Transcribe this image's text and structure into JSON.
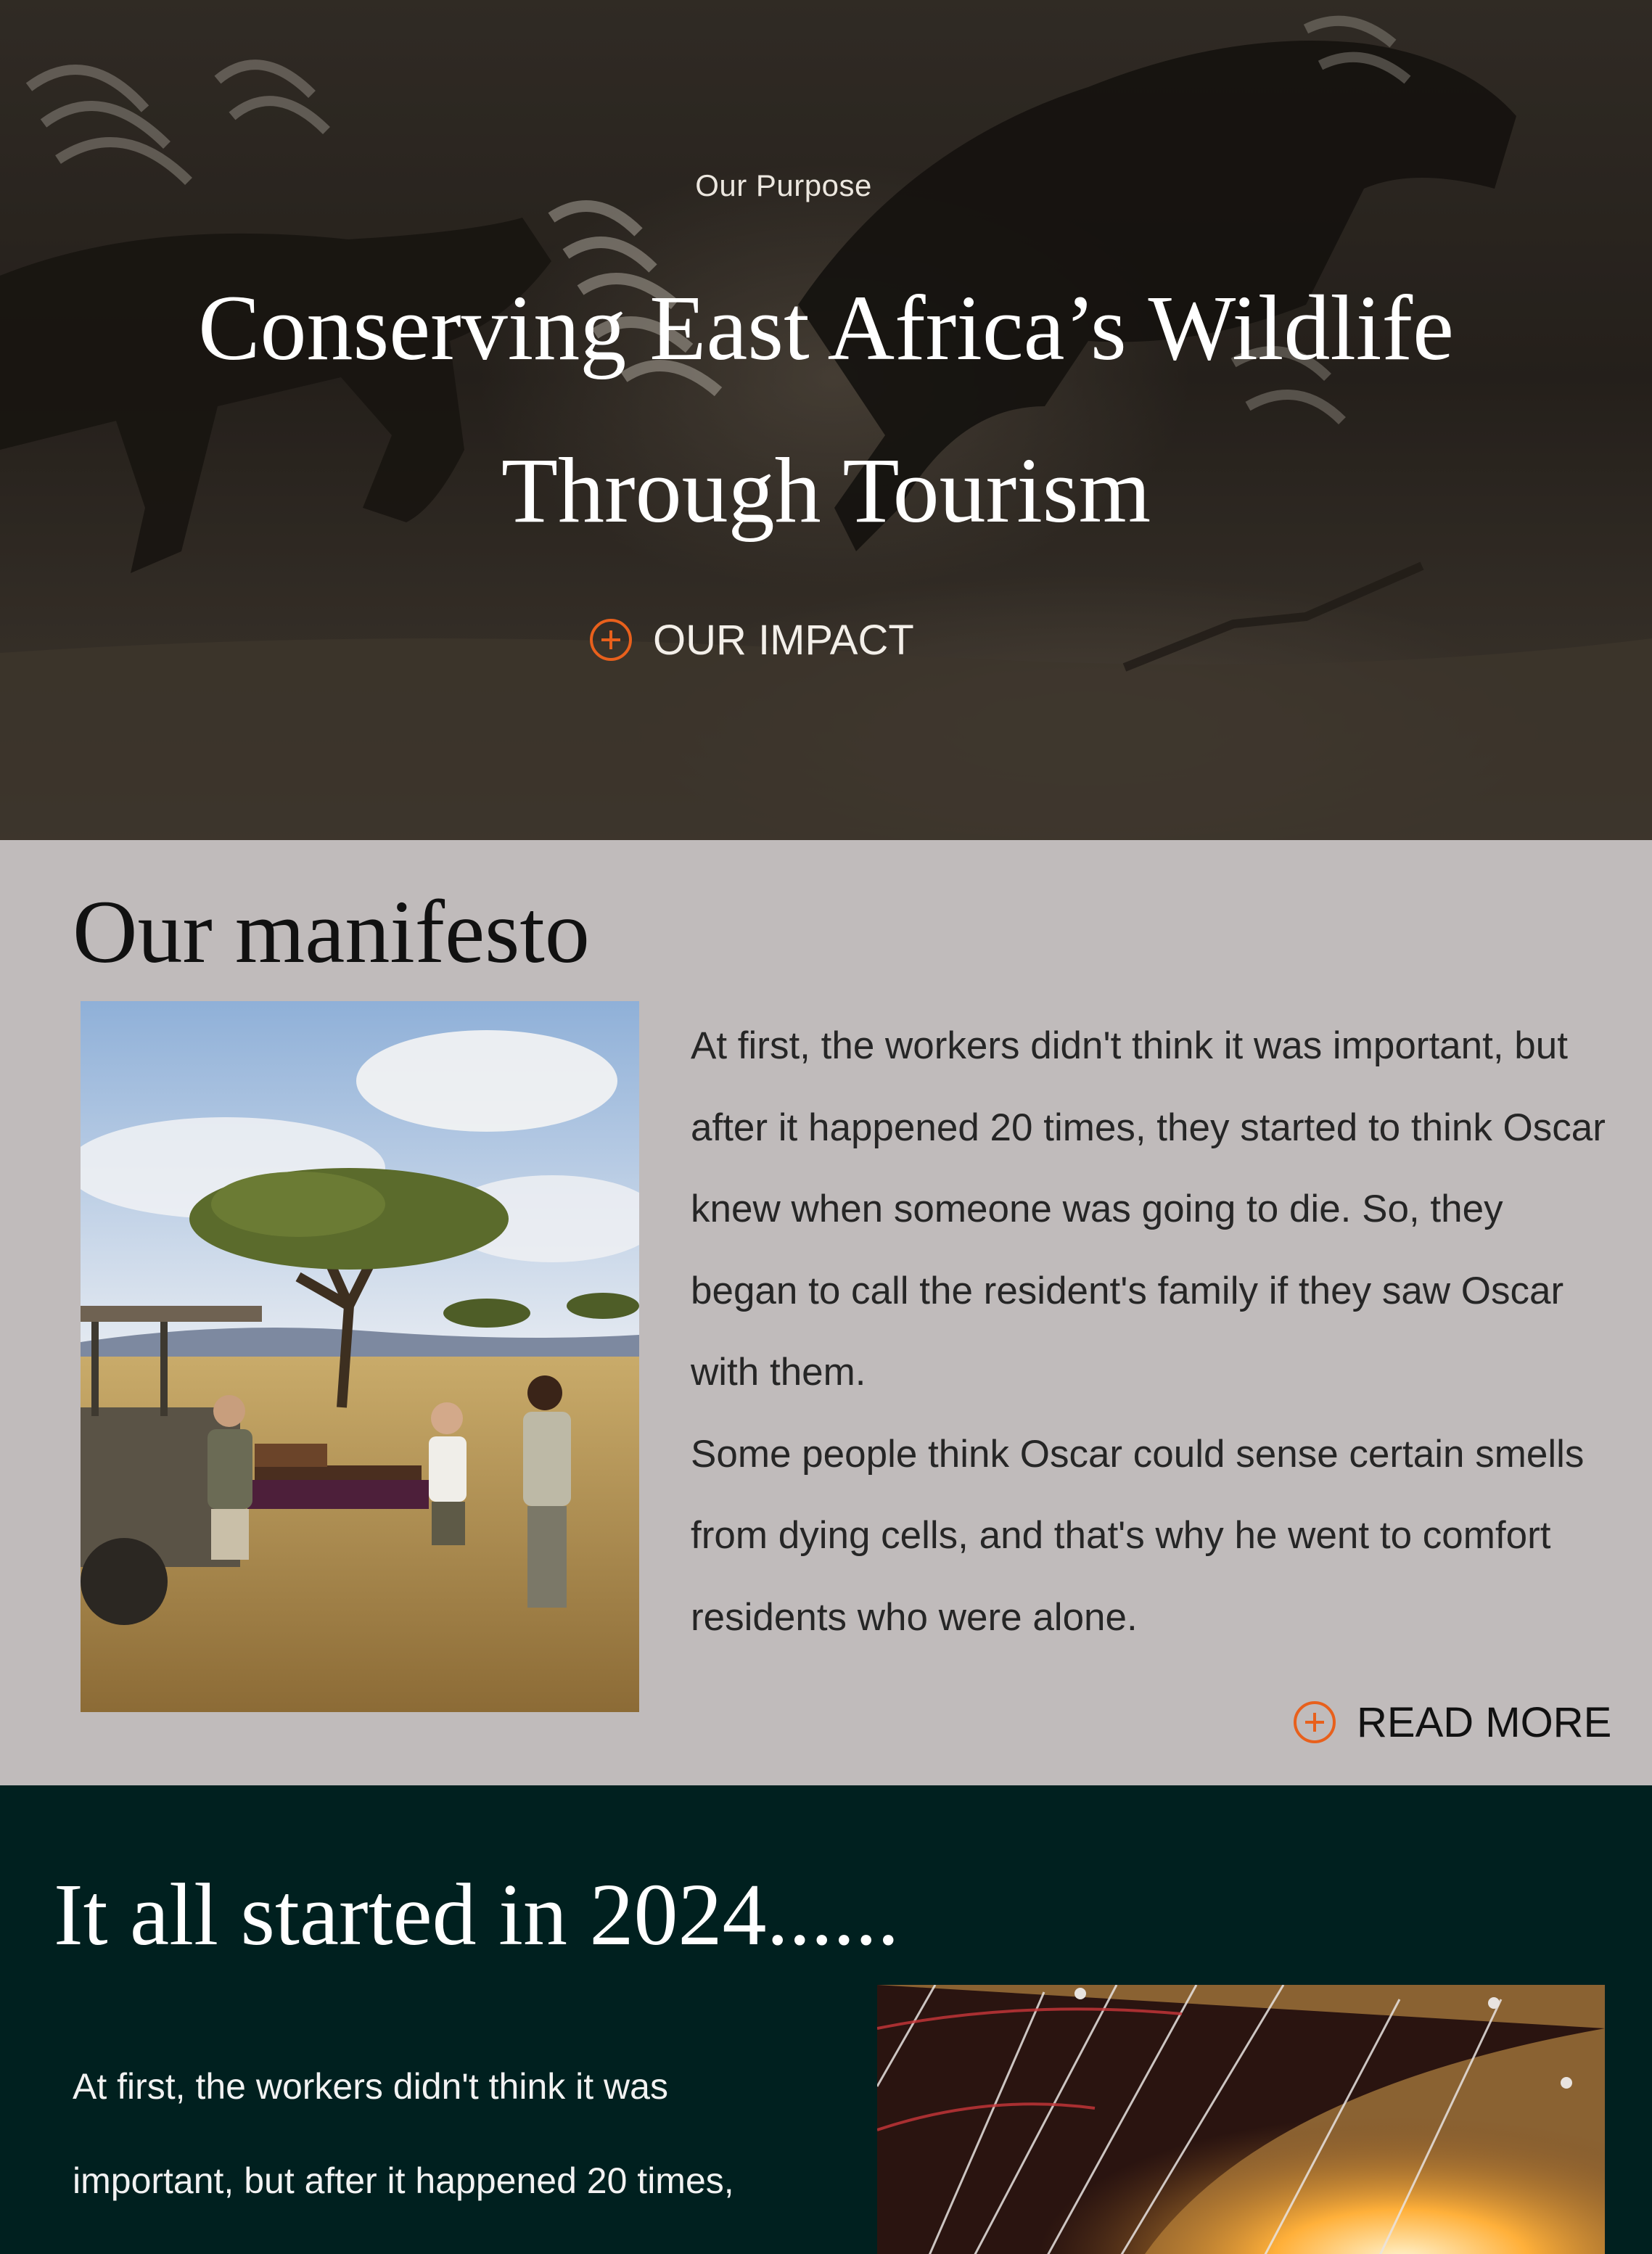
{
  "hero": {
    "eyebrow": "Our Purpose",
    "title_line1": "Conserving East Africa’s Wildlife",
    "title_line2": "Through Tourism",
    "cta_label": "OUR IMPACT",
    "cta_icon": "plus-circle-icon"
  },
  "manifesto": {
    "heading": "Our manifesto",
    "photo_alt": "safari picnic photo",
    "paragraphs": [
      "At first, the workers didn't think it was important, but after it happened 20 times, they started to think Oscar knew when someone was going to die. So, they began to call the resident's family if they saw Oscar with them.",
      "Some people think Oscar could sense certain smells from dying cells, and that's why he went to comfort residents who were alone."
    ],
    "cta_label": "READ MORE",
    "cta_icon": "plus-circle-icon"
  },
  "story": {
    "heading": "It all started in 2024......",
    "paragraph": "At first, the workers didn't think it was important, but after it happened 20 times, they started to think Oscar knew when"
  },
  "colors": {
    "accent": "#e8601c",
    "manifesto_bg": "#c0bbbb",
    "story_bg": "#00201f"
  }
}
